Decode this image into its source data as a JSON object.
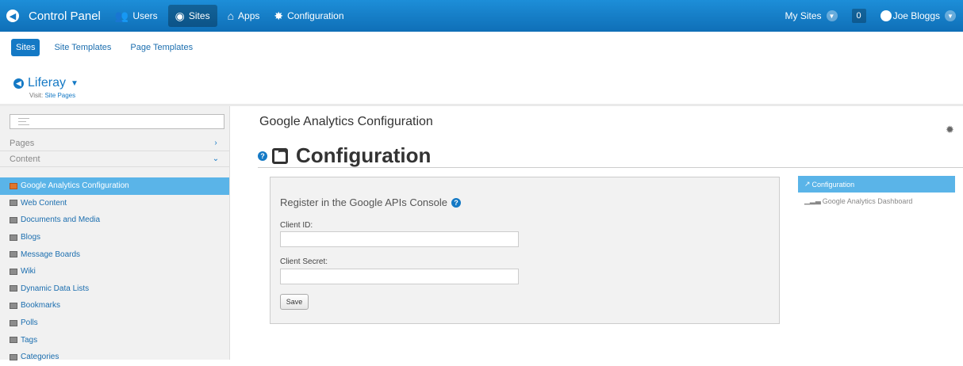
{
  "topbar": {
    "brand": "Control Panel",
    "items": [
      {
        "label": "Users",
        "icon": "users-icon"
      },
      {
        "label": "Sites",
        "icon": "globe-icon"
      },
      {
        "label": "Apps",
        "icon": "apps-icon"
      },
      {
        "label": "Configuration",
        "icon": "gear-icon"
      }
    ],
    "my_sites": "My Sites",
    "notifications": "0",
    "user": "Joe Bloggs"
  },
  "sitenav": {
    "tabs": [
      "Sites",
      "Site Templates",
      "Page Templates"
    ],
    "active": "Sites"
  },
  "site": {
    "name": "Liferay",
    "visit_label": "Visit:",
    "visit_link": "Site Pages"
  },
  "sidebar": {
    "search_placeholder": "",
    "panels": [
      {
        "label": "Pages",
        "icon": "chevron-right-icon"
      },
      {
        "label": "Content",
        "icon": "chevron-down-icon"
      }
    ],
    "items": [
      {
        "label": "Google Analytics Configuration",
        "active": true
      },
      {
        "label": "Web Content"
      },
      {
        "label": "Documents and Media"
      },
      {
        "label": "Blogs"
      },
      {
        "label": "Message Boards"
      },
      {
        "label": "Wiki"
      },
      {
        "label": "Dynamic Data Lists"
      },
      {
        "label": "Bookmarks"
      },
      {
        "label": "Polls"
      },
      {
        "label": "Tags"
      },
      {
        "label": "Categories"
      }
    ]
  },
  "main": {
    "title": "Google Analytics Configuration",
    "portlet_title": "Configuration",
    "form": {
      "legend": "Register in the Google APIs Console",
      "client_id_label": "Client ID:",
      "client_id_value": "",
      "client_secret_label": "Client Secret:",
      "client_secret_value": "",
      "save_label": "Save"
    },
    "rightnav": {
      "items": [
        "Configuration",
        "Google Analytics Dashboard"
      ]
    }
  },
  "colors": {
    "topbar": "#1479c5",
    "accent": "#5ab4e8",
    "link": "#1b6eaf"
  }
}
